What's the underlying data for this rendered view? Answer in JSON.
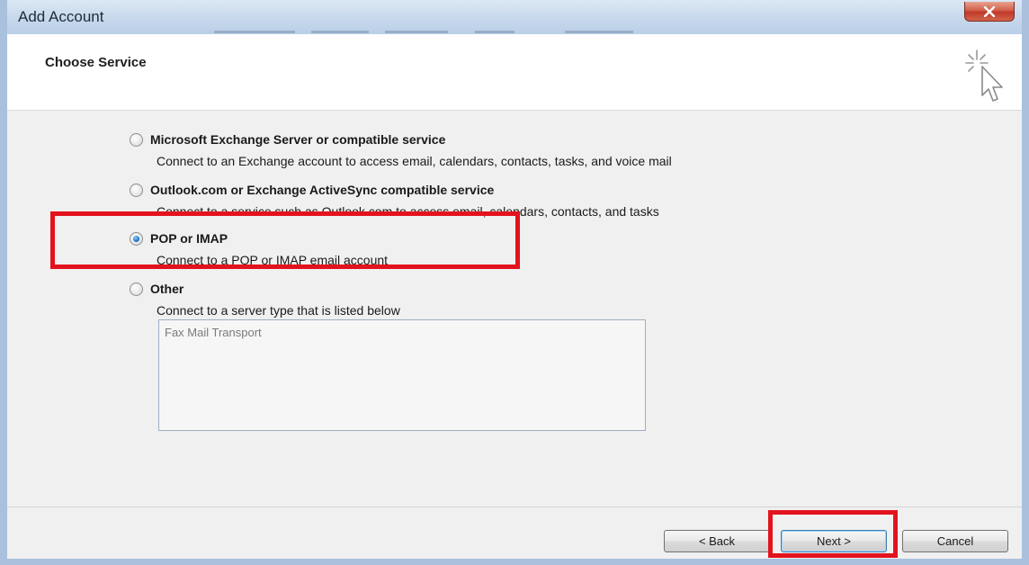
{
  "window": {
    "title": "Add Account"
  },
  "header": {
    "title": "Choose Service",
    "icon": "cursor-sparkle-icon"
  },
  "options": [
    {
      "label": "Microsoft Exchange Server or compatible service",
      "description": "Connect to an Exchange account to access email, calendars, contacts, tasks, and voice mail",
      "selected": false
    },
    {
      "label": "Outlook.com or Exchange ActiveSync compatible service",
      "description": "Connect to a service such as Outlook.com to access email, calendars, contacts, and tasks",
      "selected": false
    },
    {
      "label": "POP or IMAP",
      "description": "Connect to a POP or IMAP email account",
      "selected": true
    },
    {
      "label": "Other",
      "description": "Connect to a server type that is listed below",
      "selected": false
    }
  ],
  "server_list": {
    "items": [
      "Fax Mail Transport"
    ]
  },
  "buttons": {
    "back": "< Back",
    "next": "Next >",
    "cancel": "Cancel"
  },
  "colors": {
    "highlight": "#e3131d",
    "selected_radio": "#1f74c8"
  }
}
